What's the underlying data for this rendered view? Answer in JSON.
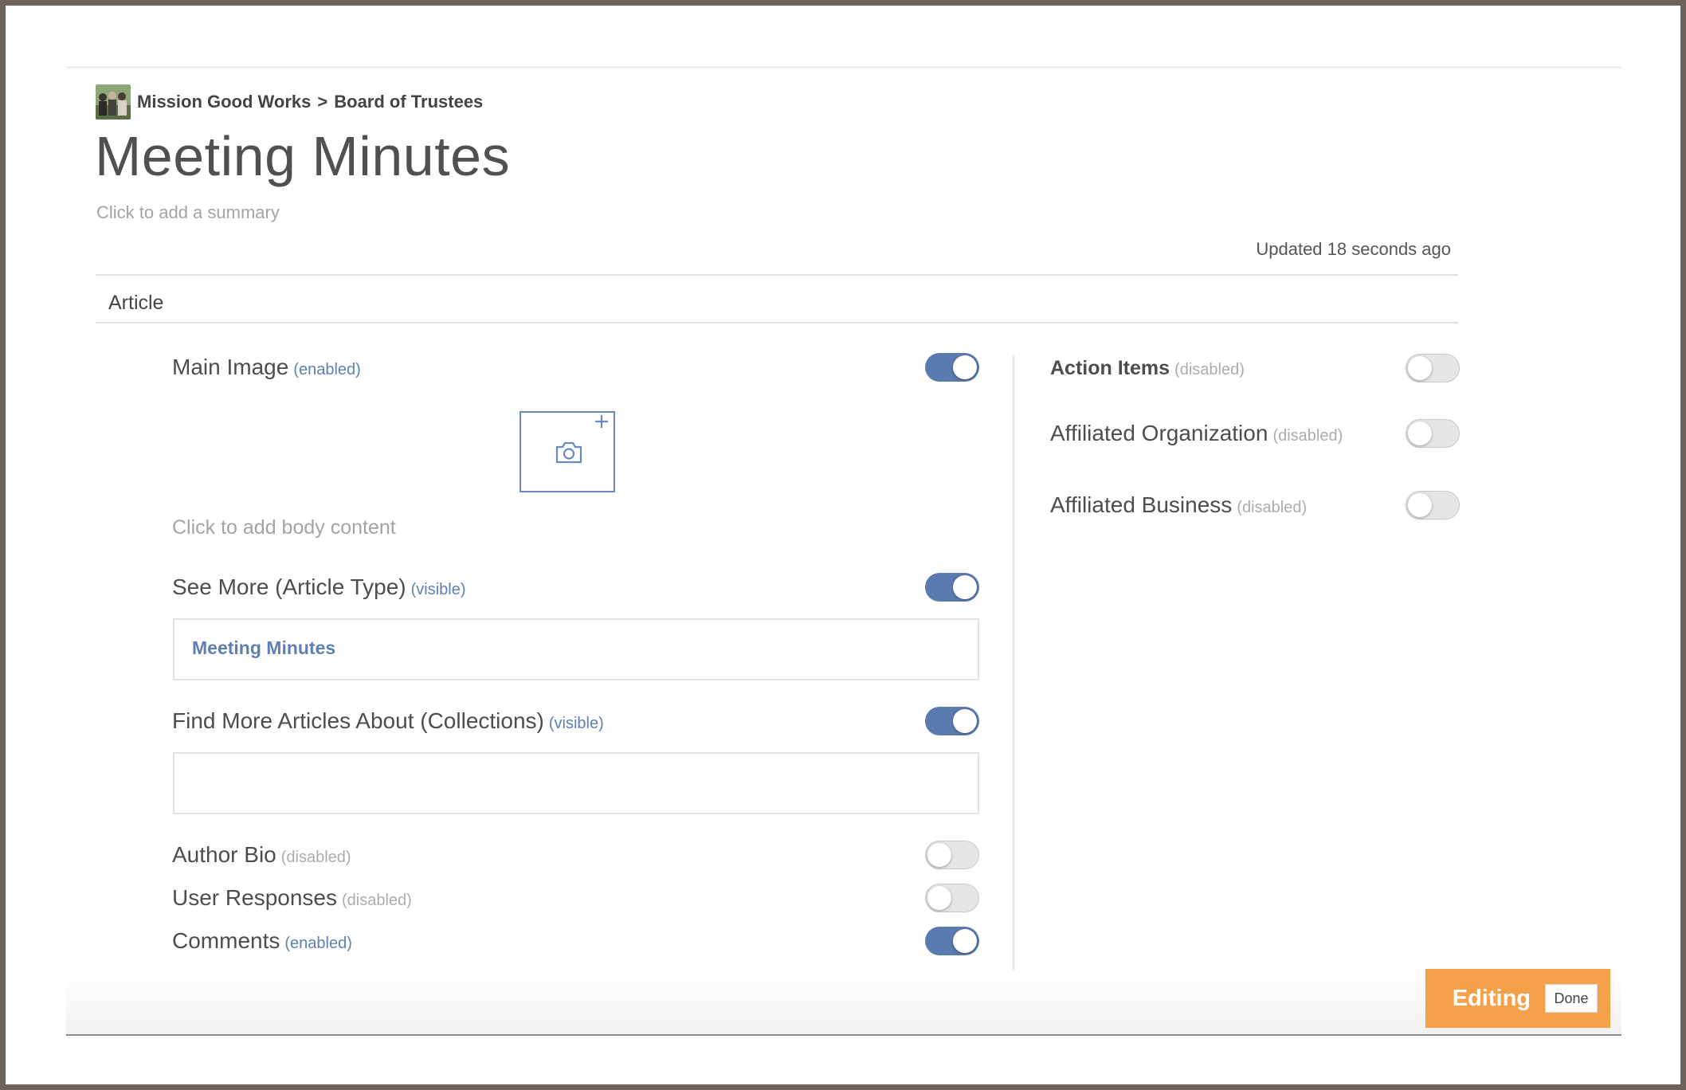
{
  "breadcrumb": {
    "organization": "Mission Good Works",
    "separator": ">",
    "group": "Board of Trustees"
  },
  "page": {
    "title": "Meeting Minutes",
    "summary_placeholder": "Click to add a summary",
    "updated": "Updated 18 seconds ago"
  },
  "section": {
    "title": "Article"
  },
  "left": {
    "main_image": {
      "label": "Main Image",
      "status": "(enabled)",
      "on": true
    },
    "body_placeholder": "Click to add body content",
    "see_more": {
      "label": "See More (Article Type)",
      "status": "(visible)",
      "on": true,
      "value": "Meeting Minutes"
    },
    "find_more": {
      "label": "Find More Articles About (Collections)",
      "status": "(visible)",
      "on": true,
      "value": ""
    },
    "author_bio": {
      "label": "Author Bio",
      "status": "(disabled)",
      "on": false
    },
    "user_responses": {
      "label": "User Responses",
      "status": "(disabled)",
      "on": false
    },
    "comments": {
      "label": "Comments",
      "status": "(enabled)",
      "on": true
    }
  },
  "right": {
    "action_items": {
      "label": "Action Items",
      "status": "(disabled)",
      "on": false
    },
    "affiliated_org": {
      "label": "Affiliated Organization",
      "status": "(disabled)",
      "on": false
    },
    "affiliated_business": {
      "label": "Affiliated Business",
      "status": "(disabled)",
      "on": false
    }
  },
  "editing": {
    "label": "Editing",
    "done_label": "Done"
  },
  "icons": {
    "avatar": "group-photo-icon",
    "image_upload": "camera-icon",
    "add": "plus-icon"
  },
  "colors": {
    "accent": "#5a7bb0",
    "editing": "#f6a04a",
    "muted": "#a3a3a3"
  }
}
